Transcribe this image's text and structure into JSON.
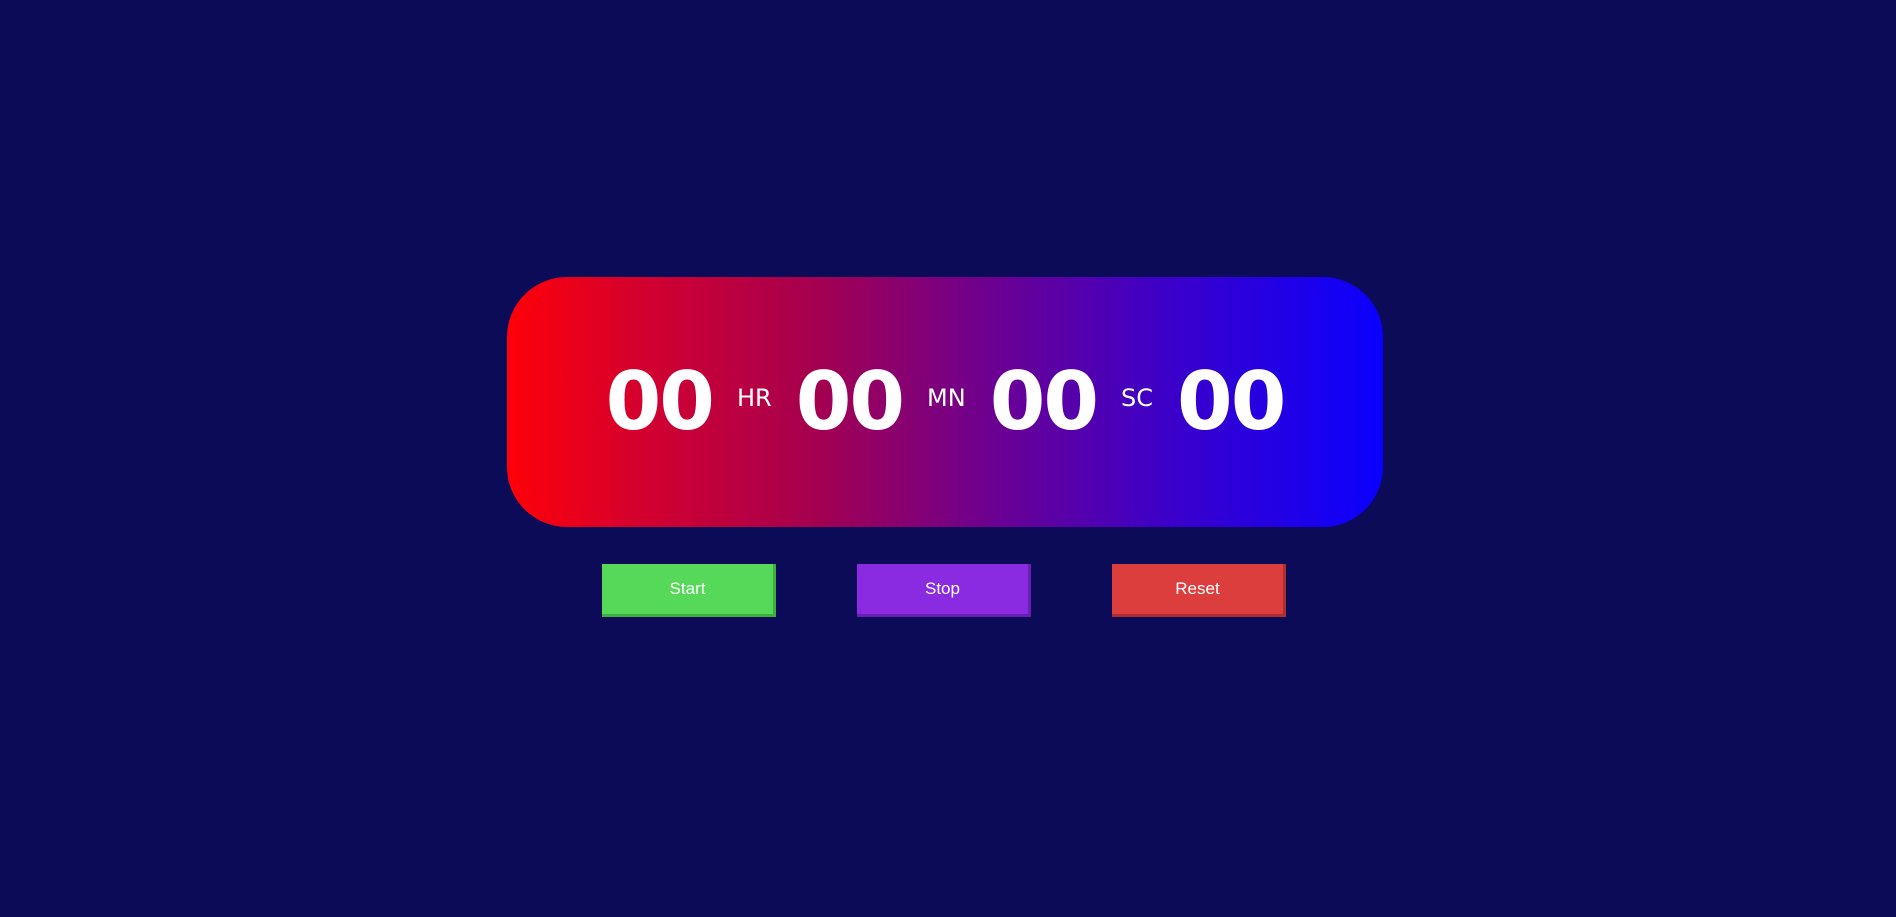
{
  "timer": {
    "hours": "00",
    "hours_unit": "HR",
    "minutes": "00",
    "minutes_unit": "MN",
    "seconds": "00",
    "seconds_unit": "SC",
    "centiseconds": "00"
  },
  "controls": {
    "start_label": "Start",
    "stop_label": "Stop",
    "reset_label": "Reset"
  },
  "colors": {
    "background": "#0c0b57",
    "gradient_start": "#ff0008",
    "gradient_end": "#0a00ff",
    "start_button": "#56d859",
    "stop_button": "#8a2be2",
    "reset_button": "#dc3d3d"
  }
}
